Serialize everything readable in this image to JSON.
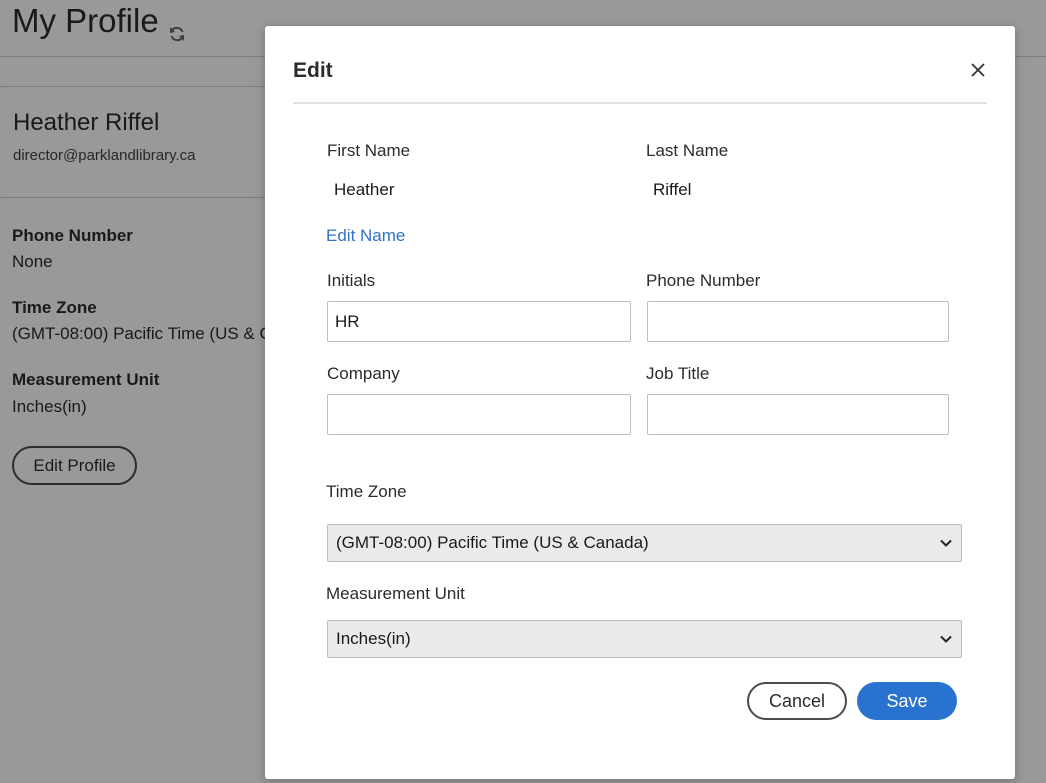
{
  "background": {
    "page_title": "My Profile",
    "profile": {
      "name": "Heather Riffel",
      "email": "director@parklandlibrary.ca"
    },
    "fields": [
      {
        "label": "Phone Number",
        "value": "None"
      },
      {
        "label": "Time Zone",
        "value": "(GMT-08:00) Pacific Time (US & Canada)"
      },
      {
        "label": "Measurement Unit",
        "value": "Inches(in)"
      }
    ],
    "edit_profile_label": "Edit Profile"
  },
  "modal": {
    "title": "Edit",
    "first_name": {
      "label": "First Name",
      "value": "Heather"
    },
    "last_name": {
      "label": "Last Name",
      "value": "Riffel"
    },
    "edit_name_label": "Edit Name",
    "initials": {
      "label": "Initials",
      "value": "HR"
    },
    "phone_number": {
      "label": "Phone Number",
      "value": ""
    },
    "company": {
      "label": "Company",
      "value": ""
    },
    "job_title": {
      "label": "Job Title",
      "value": ""
    },
    "time_zone": {
      "label": "Time Zone",
      "value": "(GMT-08:00) Pacific Time (US & Canada)"
    },
    "measurement_unit": {
      "label": "Measurement Unit",
      "value": "Inches(in)"
    },
    "cancel_label": "Cancel",
    "save_label": "Save"
  },
  "colors": {
    "accent": "#2a72cf",
    "link": "#2f74c0",
    "overlay": "rgba(0,0,0,0.4)"
  },
  "icons": {
    "refresh": "refresh-icon",
    "close": "close-icon",
    "dropdown": "chevron-down-icon"
  }
}
